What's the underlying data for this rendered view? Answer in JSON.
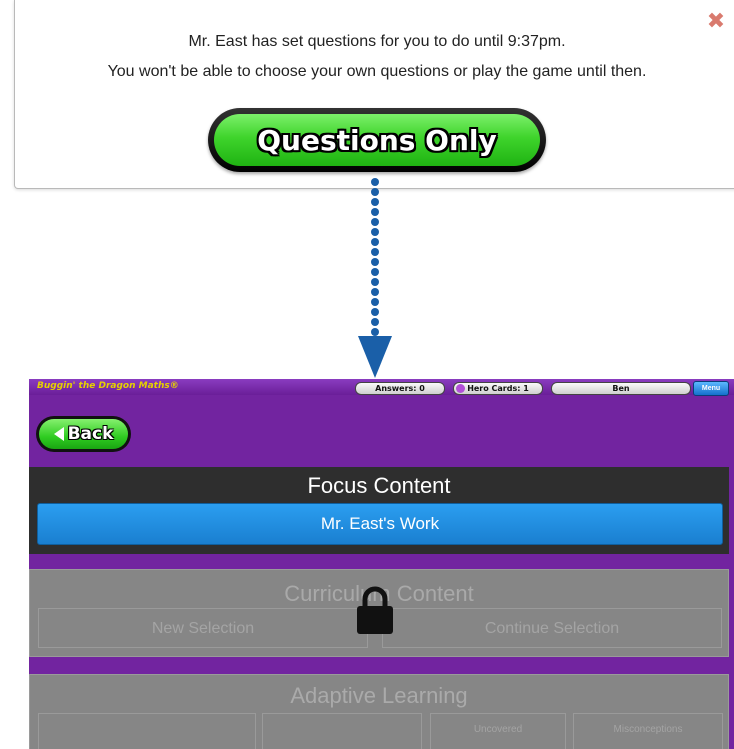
{
  "popup": {
    "message_line1": "Mr. East has set questions for you to do until 9:37pm.",
    "message_line2": "You won't be able to choose your own questions or play the game until then.",
    "button_label": "Questions Only",
    "close_symbol": "✖",
    "close_color": "#d97a6e"
  },
  "game": {
    "app_title": "Buggin' the Dragon Maths®",
    "topbar": {
      "answers": "Answers: 0",
      "hero_cards": "Hero Cards: 1",
      "user": "Ben",
      "menu": "Menu"
    },
    "back_label": "Back",
    "focus": {
      "title": "Focus Content",
      "work_button": "Mr. East's Work"
    },
    "curriculum": {
      "title": "Curriculum Content",
      "new_selection": "New Selection",
      "continue_selection": "Continue Selection",
      "locked_icon": "lock-icon"
    },
    "adaptive": {
      "title": "Adaptive Learning",
      "tile2": "",
      "tile3": "Uncovered",
      "tile4": "Misconceptions"
    },
    "colors": {
      "purple_bg": "#7224a0",
      "focus_panel": "#2e2e2e",
      "blue_button": "#1a7fd0",
      "green_button": "#2fcc21",
      "arrow_blue": "#1a5fa8"
    }
  }
}
